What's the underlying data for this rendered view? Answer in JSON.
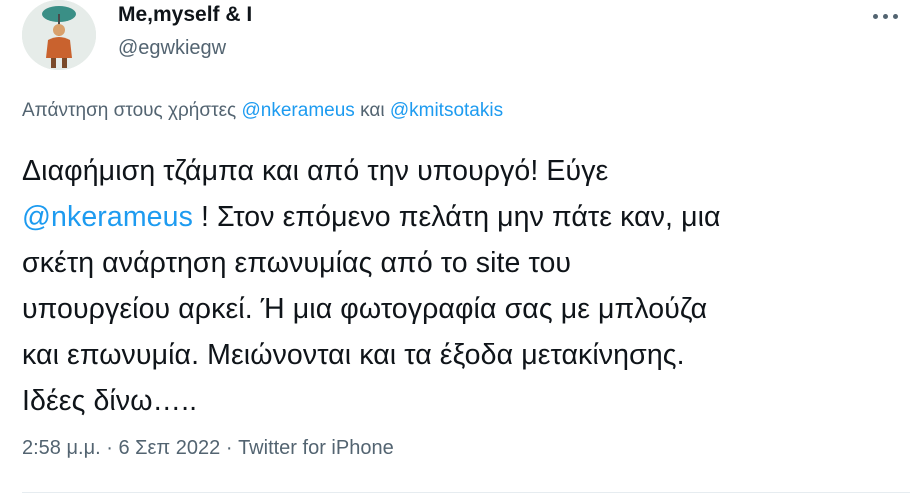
{
  "author": {
    "display_name": "Me,myself & I",
    "handle": "@egwkiegw",
    "avatar_icon": "profile-avatar"
  },
  "reply_context": {
    "prefix": "Απάντηση στους χρήστες",
    "mention_1": "@nkerameus",
    "conjunction": "και",
    "mention_2": "@kmitsotakis"
  },
  "tweet": {
    "line1": "Διαφήμιση τζάμπα και από την υπουργό! Εύγε",
    "mention": "@nkerameus",
    "line2_rest": " ! Στον επόμενο πελάτη μην πάτε καν, μια",
    "line3": "σκέτη ανάρτηση επωνυμίας από το site του",
    "line4": "υπουργείου αρκεί. Ή μια φωτογραφία σας με μπλούζα",
    "line5": "και επωνυμία. Μειώνονται και τα έξοδα μετακίνησης.",
    "line6": "Ιδέες δίνω….."
  },
  "meta": {
    "time": "2:58 μ.μ.",
    "separator": "·",
    "date": "6 Σεπ 2022",
    "source": "Twitter for iPhone"
  },
  "colors": {
    "text": "#0f1419",
    "secondary": "#536471",
    "link": "#1d9bf0"
  },
  "icons": {
    "more": "more-horizontal-icon"
  }
}
